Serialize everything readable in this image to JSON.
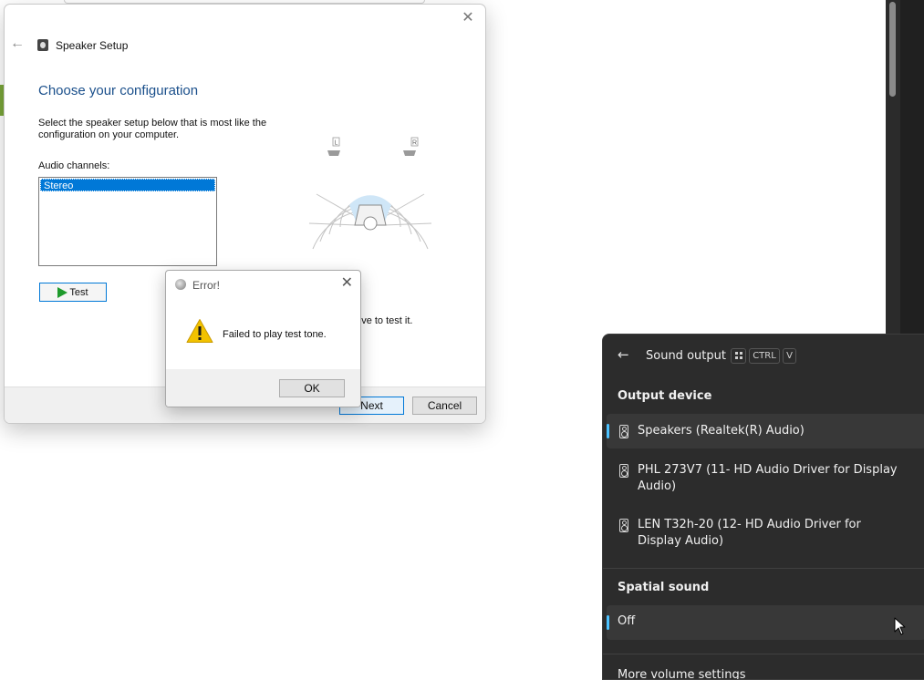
{
  "speaker_setup": {
    "title": "Speaker Setup",
    "heading": "Choose your configuration",
    "description": "Select the speaker setup below that is most like the configuration on your computer.",
    "channels_label": "Audio channels:",
    "channels": [
      "Stereo"
    ],
    "test_label": "Test",
    "hint_text": "er above to test it.",
    "speaker_labels": {
      "left": "L",
      "right": "R"
    },
    "next_label": "Next",
    "cancel_label": "Cancel"
  },
  "error_dialog": {
    "title": "Error!",
    "message": "Failed to play test tone.",
    "ok_label": "OK"
  },
  "sound_output": {
    "title": "Sound output",
    "shortcut_keys": [
      "CTRL",
      "V"
    ],
    "output_section": "Output device",
    "devices": [
      {
        "label": "Speakers (Realtek(R) Audio)",
        "selected": true
      },
      {
        "label": "PHL 273V7 (11- HD Audio Driver for Display Audio)",
        "selected": false
      },
      {
        "label": "LEN T32h-20 (12- HD Audio Driver for Display Audio)",
        "selected": false
      }
    ],
    "spatial_section": "Spatial sound",
    "spatial_value": "Off",
    "more_label": "More volume settings"
  },
  "colors": {
    "accent": "#0078d7",
    "heading": "#1a4f8b",
    "flyout_bg": "#2c2c2c",
    "flyout_accent": "#4cc2ff",
    "warning": "#f2c200"
  }
}
